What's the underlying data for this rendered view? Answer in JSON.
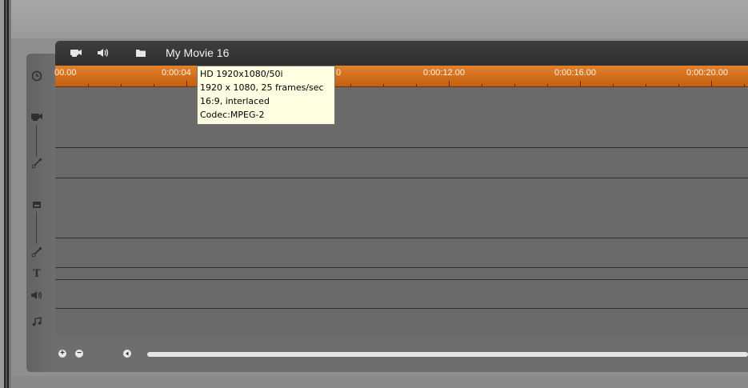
{
  "header": {
    "title": "My Movie 16",
    "icons": [
      "video-camera-icon",
      "speaker-icon",
      "folder-icon"
    ]
  },
  "ruler": {
    "labels": [
      "00.00",
      "0:00:04",
      "0",
      "0:00:12.00",
      "0:00:16.00",
      "0:00:20.00"
    ]
  },
  "tooltip": {
    "line1": "HD 1920x1080/50i",
    "line2": "1920 x 1080, 25 frames/sec",
    "line3": "16:9, interlaced",
    "line4": "Codec:MPEG-2"
  },
  "sidebar": {
    "icons": [
      "clock-icon",
      "video-track-icon",
      "video-edit-pen-icon",
      "overlay-track-icon",
      "overlay-edit-pen-icon",
      "title-track-icon",
      "audio-track-icon",
      "music-track-icon"
    ],
    "title_glyph": "T"
  },
  "footer": {
    "zoom_in": "+",
    "zoom_out": "−"
  }
}
